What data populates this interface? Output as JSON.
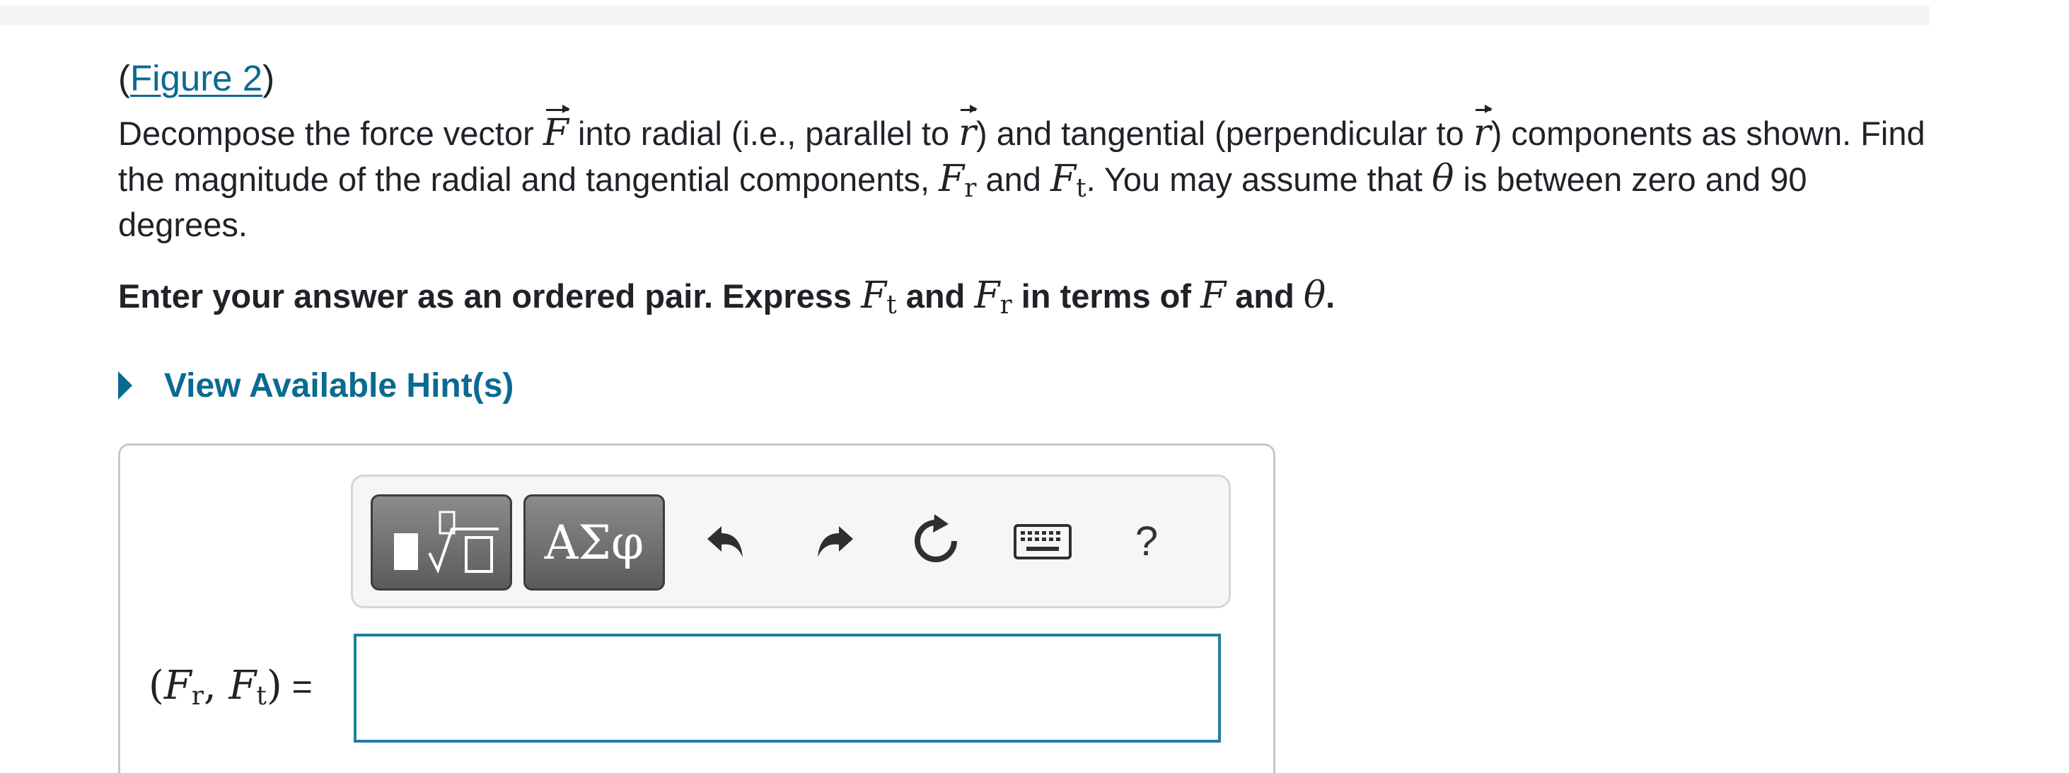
{
  "figure_link": {
    "open_paren": "(",
    "label": "Figure 2",
    "close_paren": ")"
  },
  "problem": {
    "t1": "Decompose the force vector ",
    "F": "F",
    "t2": " into radial (i.e., parallel to ",
    "r1": "r",
    "t3": ") and tangential (perpendicular to ",
    "r2": "r",
    "t4": ") components as shown. Find the magnitude of the radial and tangential components, ",
    "Fr_base": "F",
    "Fr_sub": "r",
    "t5": " and ",
    "Ft_base": "F",
    "Ft_sub": "t",
    "t6": ". You may assume that ",
    "theta": "θ",
    "t7": " is between zero and 90 degrees."
  },
  "instructions": {
    "t1": "Enter your answer as an ordered pair. Express ",
    "Ft_base": "F",
    "Ft_sub": "t",
    "t2": " and ",
    "Fr_base": "F",
    "Fr_sub": "r",
    "t3": " in terms of ",
    "F": "F",
    "t4": " and ",
    "theta": "θ",
    "t5": "."
  },
  "hints": {
    "label": "View Available Hint(s)"
  },
  "toolbar": {
    "templates_icon": "templates-sqrt-icon",
    "symbols_label": "ΑΣφ",
    "undo_icon": "undo-icon",
    "redo_icon": "redo-icon",
    "reset_icon": "reset-icon",
    "keyboard_icon": "keyboard-icon",
    "help_label": "?"
  },
  "answer": {
    "open_paren": "(",
    "Fr_base": "F",
    "Fr_sub": "r",
    "comma": ", ",
    "Ft_base": "F",
    "Ft_sub": "t",
    "close_paren": ")",
    "equals": " =",
    "value": ""
  },
  "colors": {
    "link": "#0a6a92",
    "input_border": "#1f7da0",
    "button_dark": "#5b5b5b"
  }
}
